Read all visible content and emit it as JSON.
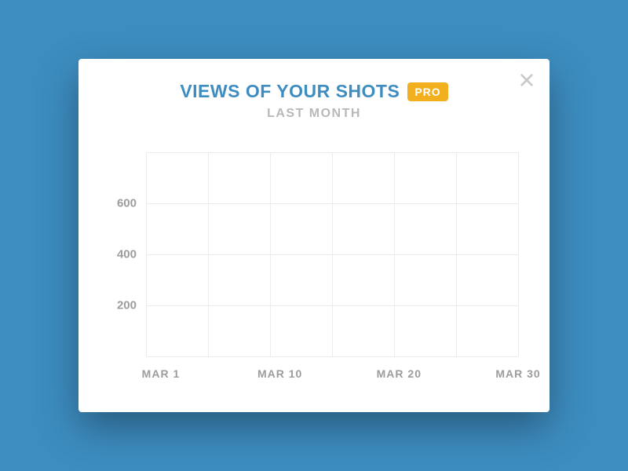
{
  "header": {
    "title": "VIEWS OF YOUR SHOTS",
    "badge": "PRO",
    "subtitle": "LAST MONTH"
  },
  "chart_data": {
    "type": "line",
    "title": "Views of your shots — last month",
    "xlabel": "",
    "ylabel": "",
    "x_ticks": [
      "MAR 1",
      "MAR 10",
      "MAR 20",
      "MAR 30"
    ],
    "y_ticks": [
      200,
      400,
      600
    ],
    "ylim": [
      0,
      800
    ],
    "series": [],
    "grid": true
  },
  "colors": {
    "background": "#3d8dc1",
    "card": "#ffffff",
    "title": "#3d8dc1",
    "badge_bg": "#f2b01e",
    "badge_fg": "#ffffff",
    "muted": "#b8b8b8",
    "axis": "#9c9c9c",
    "grid": "#ececec"
  }
}
